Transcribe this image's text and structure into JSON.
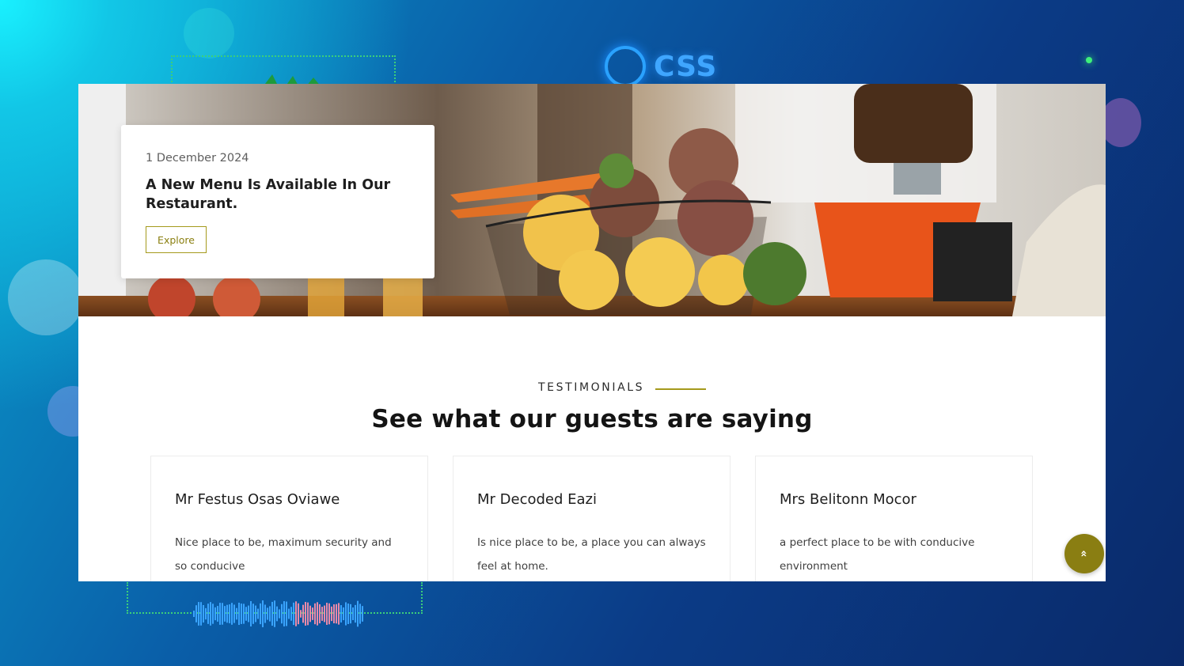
{
  "overlay": {
    "logo_text": "CSS"
  },
  "hero": {
    "date": "1 December 2024",
    "title": "A New Menu Is Available In Our Restaurant.",
    "explore_label": "Explore"
  },
  "testimonials": {
    "eyebrow": "TESTIMONIALS",
    "heading": "See what our guests are saying",
    "items": [
      {
        "name": "Mr Festus Osas Oviawe",
        "text": "Nice place to be, maximum security and so conducive"
      },
      {
        "name": "Mr Decoded Eazi",
        "text": "Is nice place to be, a place you can always feel at home."
      },
      {
        "name": "Mrs Belitonn Mocor",
        "text": "a perfect place to be with conducive environment"
      }
    ]
  },
  "scroll_top": {
    "icon": "double-chevron-up-icon",
    "glyph": "»"
  },
  "colors": {
    "accent": "#a59a1c",
    "accent_dark": "#8a7e12"
  }
}
